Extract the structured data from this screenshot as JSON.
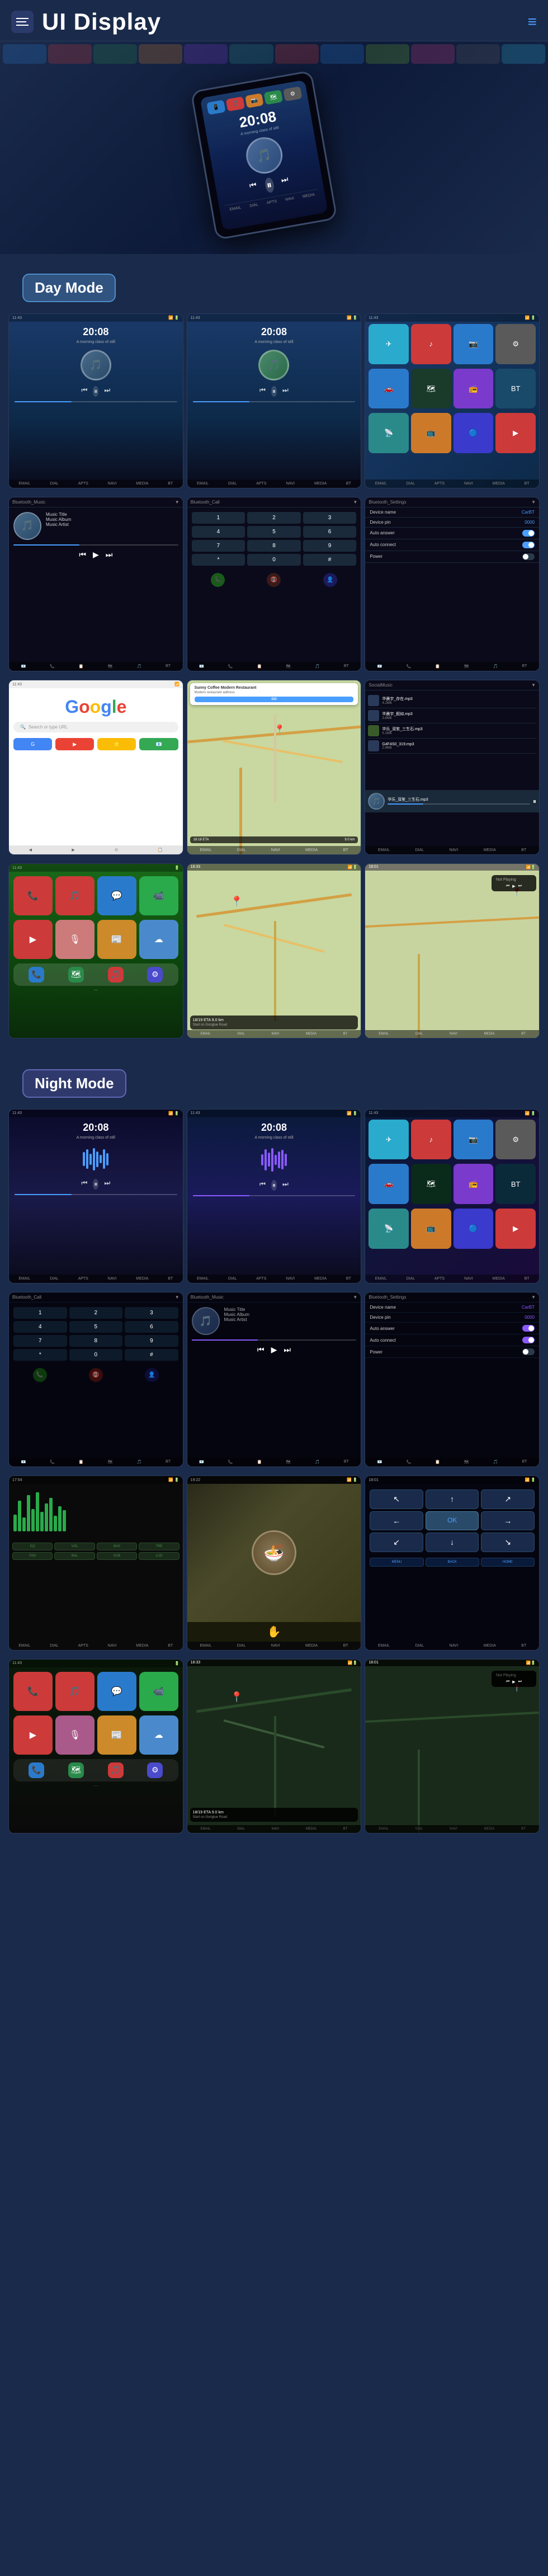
{
  "header": {
    "title": "UI Display",
    "menu_icon": "☰",
    "nav_icon": "≡"
  },
  "day_mode": {
    "label": "Day Mode"
  },
  "night_mode": {
    "label": "Night Mode"
  },
  "music": {
    "time": "20:08",
    "title": "Music Title",
    "album": "Music Album",
    "artist": "Music Artist"
  },
  "settings": {
    "title": "Bluetooth_Settings",
    "device_name_label": "Device name",
    "device_name_value": "CarBT",
    "device_pin_label": "Device pin",
    "device_pin_value": "0000",
    "auto_answer_label": "Auto answer",
    "auto_connect_label": "Auto connect",
    "power_label": "Power"
  },
  "call": {
    "title": "Bluetooth_Call"
  },
  "bluetooth_music": {
    "title": "Bluetooth_Music"
  },
  "social": {
    "title": "SocialMusic"
  },
  "google": {
    "logo": "G",
    "search_placeholder": "Search or type URL"
  },
  "map": {
    "destination": "Sunny Coffee Modern Restaurant",
    "eta": "18:18 ETA",
    "distance": "9.0 km",
    "go_label": "GO",
    "direction": "Start on Gonglue Road"
  },
  "nav_bar": {
    "items": [
      "EMAIL",
      "DIAL",
      "APTS",
      "NAVI",
      "MEDIA",
      "BT"
    ]
  }
}
